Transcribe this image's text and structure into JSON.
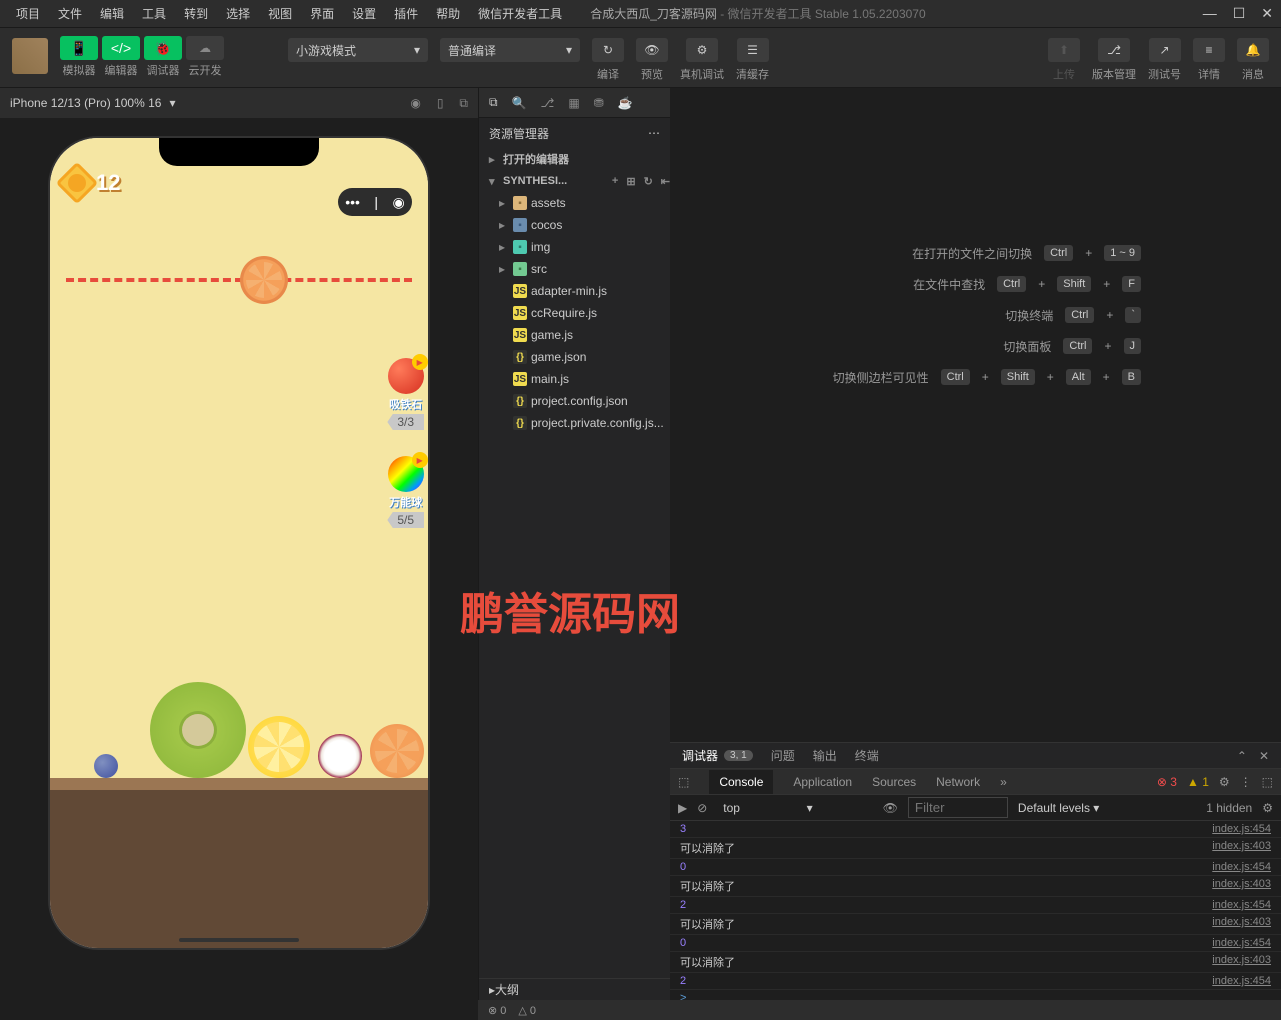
{
  "menubar": [
    "项目",
    "文件",
    "编辑",
    "工具",
    "转到",
    "选择",
    "视图",
    "界面",
    "设置",
    "插件",
    "帮助",
    "微信开发者工具"
  ],
  "title": {
    "project": "合成大西瓜_刀客源码网",
    "app": "微信开发者工具 Stable 1.05.2203070"
  },
  "toolbar": {
    "labels": {
      "simulator": "模拟器",
      "editor": "编辑器",
      "debugger": "调试器",
      "cloud": "云开发"
    },
    "mode_dropdown": "小游戏模式",
    "compile_dropdown": "普通编译",
    "actions": {
      "compile": "编译",
      "preview": "预览",
      "realdevice": "真机调试",
      "clearcache": "清缓存"
    },
    "right": {
      "upload": "上传",
      "version": "版本管理",
      "testno": "测试号",
      "details": "详情",
      "messages": "消息"
    }
  },
  "simulator": {
    "device": "iPhone 12/13 (Pro) 100% 16"
  },
  "game": {
    "score": "12",
    "powerup1": {
      "label": "吸铁石",
      "count": "3/3"
    },
    "powerup2": {
      "label": "万能球",
      "count": "5/5"
    }
  },
  "explorer": {
    "title": "资源管理器",
    "opened_editors": "打开的编辑器",
    "project_name": "SYNTHESI...",
    "tree": [
      {
        "type": "folder",
        "name": "assets",
        "icon": "folder"
      },
      {
        "type": "folder",
        "name": "cocos",
        "icon": "folder-dark"
      },
      {
        "type": "folder",
        "name": "img",
        "icon": "folder-img"
      },
      {
        "type": "folder",
        "name": "src",
        "icon": "folder-src"
      },
      {
        "type": "file",
        "name": "adapter-min.js",
        "icon": "js"
      },
      {
        "type": "file",
        "name": "ccRequire.js",
        "icon": "js"
      },
      {
        "type": "file",
        "name": "game.js",
        "icon": "js"
      },
      {
        "type": "file",
        "name": "game.json",
        "icon": "json"
      },
      {
        "type": "file",
        "name": "main.js",
        "icon": "js"
      },
      {
        "type": "file",
        "name": "project.config.json",
        "icon": "json"
      },
      {
        "type": "file",
        "name": "project.private.config.js...",
        "icon": "json"
      }
    ],
    "outline": "大纲"
  },
  "watermark": "鹏誉源码网",
  "shortcuts": [
    {
      "label": "在打开的文件之间切换",
      "keys": [
        "Ctrl",
        "1 ~ 9"
      ],
      "plus": [
        false
      ]
    },
    {
      "label": "在文件中查找",
      "keys": [
        "Ctrl",
        "Shift",
        "F"
      ],
      "plus": [
        true,
        true
      ]
    },
    {
      "label": "切换终端",
      "keys": [
        "Ctrl",
        "`"
      ],
      "plus": [
        true
      ]
    },
    {
      "label": "切换面板",
      "keys": [
        "Ctrl",
        "J"
      ],
      "plus": [
        true
      ]
    },
    {
      "label": "切换侧边栏可见性",
      "keys": [
        "Ctrl",
        "Shift",
        "Alt",
        "B"
      ],
      "plus": [
        true,
        true,
        true
      ]
    }
  ],
  "debugger": {
    "tabs": {
      "debugger": "调试器",
      "count": "3, 1",
      "problems": "问题",
      "output": "输出",
      "terminal": "终端"
    },
    "devtools_tabs": [
      "Console",
      "Application",
      "Sources",
      "Network"
    ],
    "errors": "3",
    "warnings": "1",
    "console_toolbar": {
      "context": "top",
      "filter_placeholder": "Filter",
      "levels": "Default levels",
      "hidden": "1 hidden"
    },
    "logs": [
      {
        "msg": "3",
        "type": "num",
        "src": "index.js:454"
      },
      {
        "msg": "可以消除了",
        "type": "text",
        "src": "index.js:403"
      },
      {
        "msg": "0",
        "type": "num",
        "src": "index.js:454"
      },
      {
        "msg": "可以消除了",
        "type": "text",
        "src": "index.js:403"
      },
      {
        "msg": "2",
        "type": "num",
        "src": "index.js:454"
      },
      {
        "msg": "可以消除了",
        "type": "text",
        "src": "index.js:403"
      },
      {
        "msg": "0",
        "type": "num",
        "src": "index.js:454"
      },
      {
        "msg": "可以消除了",
        "type": "text",
        "src": "index.js:403"
      },
      {
        "msg": "2",
        "type": "num",
        "src": "index.js:454"
      }
    ]
  },
  "statusbar": {
    "errors": "0",
    "warnings": "0"
  }
}
